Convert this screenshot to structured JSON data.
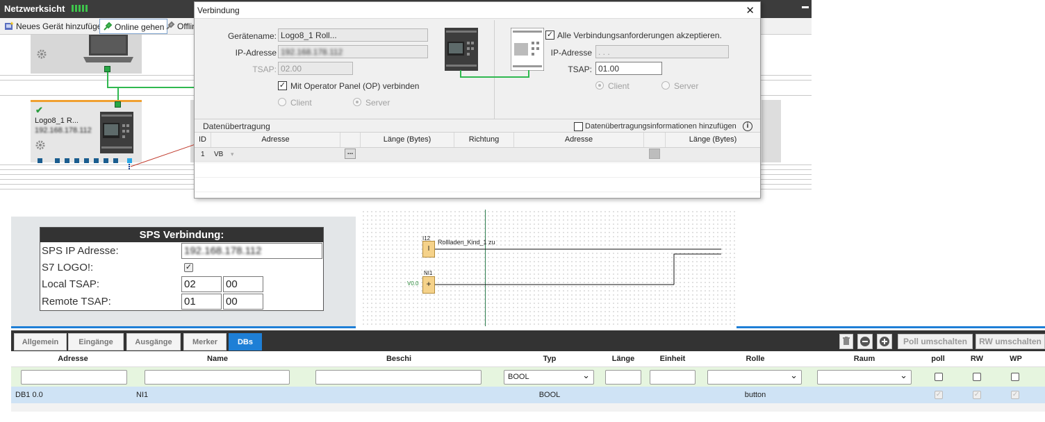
{
  "network": {
    "title": "Netzwerksicht",
    "toolbar": {
      "add_device": "Neues Gerät hinzufügen",
      "go_online": "Online gehen",
      "go_offline": "Offlin"
    },
    "device": {
      "name": "Logo8_1 R...",
      "ip": "192.168.178.112"
    }
  },
  "dialog": {
    "title": "Verbindung",
    "close": "✕",
    "left": {
      "device_name_label": "Gerätename:",
      "device_name_value": "Logo8_1 Roll...",
      "ip_label": "IP-Adresse",
      "ip_value": "192.168.178.112",
      "tsap_label": "TSAP:",
      "tsap_value": "02.00",
      "op_label": "Mit Operator Panel (OP) verbinden",
      "op_checked": "✓",
      "client_label": "Client",
      "server_label": "Server"
    },
    "right": {
      "accept_label": "Alle Verbindungsanforderungen akzeptieren.",
      "accept_checked": "✓",
      "ip_label": "IP-Adresse",
      "ip_value": ". . .",
      "tsap_label": "TSAP:",
      "tsap_value": "01.00",
      "client_label": "Client",
      "server_label": "Server"
    },
    "transfer": {
      "title": "Datenübertragung",
      "add_info_label": "Datenübertragungsinformationen hinzufügen",
      "info_icon": "i",
      "headers": [
        "ID",
        "Adresse",
        "Länge (Bytes)",
        "Richtung",
        "Adresse",
        "Länge (Bytes)"
      ],
      "rows": [
        {
          "id": "1",
          "address": "VB"
        }
      ],
      "ellipsis": "..."
    }
  },
  "sps": {
    "title": "SPS Verbindung:",
    "ip_label": "SPS IP Adresse:",
    "ip_value": "192.168.178.112",
    "logo_label": "S7 LOGO!:",
    "logo_checked": "✓",
    "local_tsap_label": "Local TSAP:",
    "local_tsap": [
      "02",
      "00"
    ],
    "remote_tsap_label": "Remote TSAP:",
    "remote_tsap": [
      "01",
      "00"
    ]
  },
  "ladder": {
    "block1_id": "I12",
    "block1_symbol": "I",
    "block1_label": "Rollladen_Kind_1 zu",
    "block2_id": "NI1",
    "block2_symbol": "+",
    "block2_label": "V0.0"
  },
  "table": {
    "tabs": [
      "Allgemein",
      "Eingänge",
      "Ausgänge",
      "Merker",
      "DBs"
    ],
    "active_tab": "DBs",
    "actions": {
      "poll_toggle": "Poll umschalten",
      "rw_toggle": "RW umschalten"
    },
    "columns": [
      "Adresse",
      "Name",
      "Beschi",
      "Typ",
      "Länge",
      "Einheit",
      "Rolle",
      "Raum",
      "poll",
      "RW",
      "WP"
    ],
    "filter": {
      "type_value": "BOOL"
    },
    "rows": [
      {
        "address": "DB1 0.0",
        "name": "NI1",
        "type": "BOOL",
        "role": "button",
        "poll": "✓",
        "rw": "✓",
        "wp": "✓"
      }
    ]
  },
  "colors": {
    "accent": "#1e7fd6",
    "header_dark": "#333333",
    "filter_row": "#e6f5df",
    "selected_row": "#cfe3f5",
    "connection_green": "#2fb84f",
    "connection_line_red": "#c0392b"
  }
}
